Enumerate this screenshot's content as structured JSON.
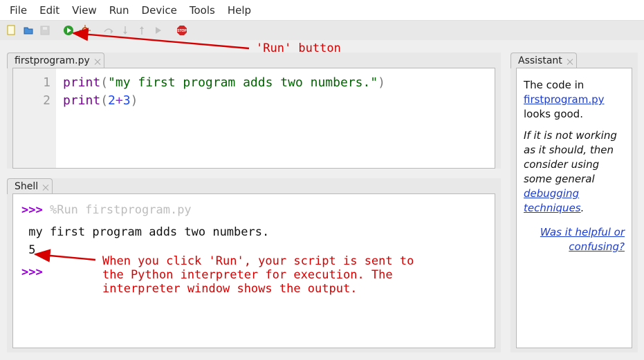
{
  "menubar": [
    "File",
    "Edit",
    "View",
    "Run",
    "Device",
    "Tools",
    "Help"
  ],
  "toolbar": {
    "icons": [
      "new-file-icon",
      "open-file-icon",
      "save-icon",
      "run-icon",
      "debug-icon",
      "step-over-icon",
      "step-into-icon",
      "step-out-icon",
      "resume-icon",
      "stop-icon"
    ]
  },
  "editor": {
    "tab_label": "firstprogram.py",
    "lines": [
      {
        "num": "1",
        "tokens": [
          {
            "t": "print",
            "cls": "tok-func"
          },
          {
            "t": "(",
            "cls": "tok-par"
          },
          {
            "t": "\"my first program adds two numbers.\"",
            "cls": "tok-str"
          },
          {
            "t": ")",
            "cls": "tok-par"
          }
        ]
      },
      {
        "num": "2",
        "tokens": [
          {
            "t": "print",
            "cls": "tok-func"
          },
          {
            "t": "(",
            "cls": "tok-par"
          },
          {
            "t": "2",
            "cls": "tok-num"
          },
          {
            "t": "+",
            "cls": "tok-op"
          },
          {
            "t": "3",
            "cls": "tok-num"
          },
          {
            "t": ")",
            "cls": "tok-par"
          }
        ]
      }
    ]
  },
  "shell": {
    "tab_label": "Shell",
    "prompt": ">>>",
    "run_cmd": "%Run firstprogram.py",
    "output_lines": [
      " my first program adds two numbers.",
      " 5"
    ]
  },
  "assistant": {
    "tab_label": "Assistant",
    "para1_pre": "The code in ",
    "para1_link": "firstprogram.py",
    "para1_post": " looks good.",
    "para2_pre": "If it is not working as it should, then consider using some general ",
    "para2_link": "debugging techniques",
    "para2_post": ".",
    "feedback": "Was it helpful or confusing?"
  },
  "annotations": {
    "run_label": "'Run' button",
    "shell_note": "When you click 'Run', your script is sent to\nthe Python interpreter for execution. The\ninterpreter window shows the output."
  }
}
